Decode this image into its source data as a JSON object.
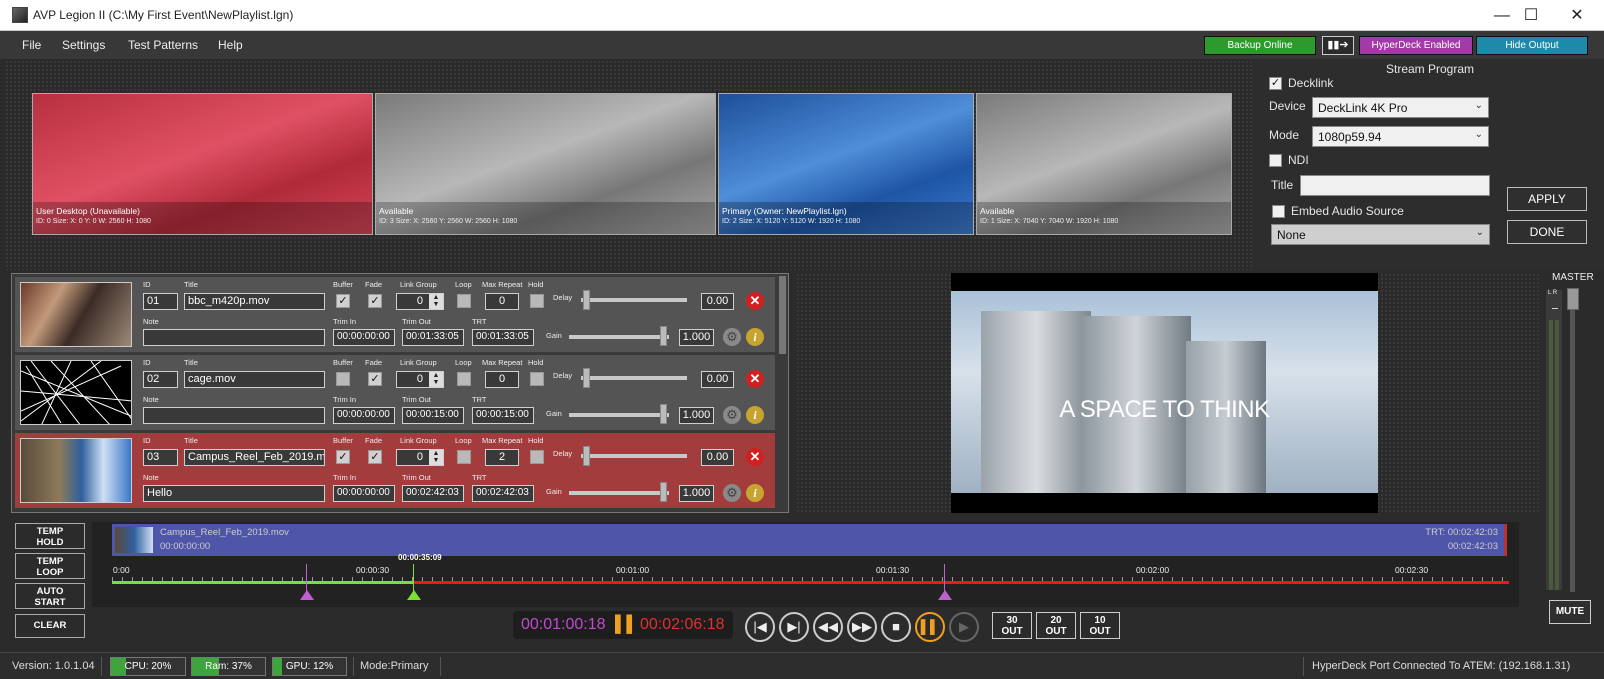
{
  "window": {
    "title": "AVP Legion II (C:\\My First Event\\NewPlaylist.lgn)",
    "minimize": "—",
    "maximize": "☐",
    "close": "✕"
  },
  "menu": [
    "File",
    "Settings",
    "Test Patterns",
    "Help"
  ],
  "topbar": {
    "backup": "Backup Online",
    "hyperdeck": "HyperDeck Enabled",
    "hide_output": "Hide Output"
  },
  "displays": [
    {
      "title": "User Desktop (Unavailable)",
      "info": "ID: 0 Size: X: 0 Y: 0 W: 2560 H: 1080",
      "color": "#c8394a"
    },
    {
      "title": "Available",
      "info": "ID: 3 Size: X: 2560 Y: 2560 W: 2560 H: 1080",
      "color": "#8a8a8a"
    },
    {
      "title": "Primary (Owner: NewPlaylist.lgn)",
      "info": "ID: 2 Size: X: 5120 Y: 5120 W: 1920 H: 1080",
      "color": "#2e68b8"
    },
    {
      "title": "Available",
      "info": "ID: 1 Size: X: 7040 Y: 7040 W: 1920 H: 1080",
      "color": "#8a8a8a"
    }
  ],
  "stream": {
    "heading": "Stream Program",
    "decklink_label": "Decklink",
    "decklink_checked": true,
    "device_label": "Device",
    "device_value": "DeckLink 4K Pro",
    "mode_label": "Mode",
    "mode_value": "1080p59.94",
    "ndi_label": "NDI",
    "title_label": "Title",
    "title_value": "",
    "embed_label": "Embed Audio Source",
    "embed_value": "None",
    "apply": "APPLY",
    "done": "DONE"
  },
  "field_labels": {
    "id": "ID",
    "title": "Title",
    "buffer": "Buffer",
    "fade": "Fade",
    "link_group": "Link Group",
    "loop": "Loop",
    "max_repeat": "Max Repeat",
    "hold": "Hold",
    "delay": "Delay",
    "note": "Note",
    "trim_in": "Trim In",
    "trim_out": "Trim Out",
    "trt": "TRT",
    "gain": "Gain"
  },
  "playlist": [
    {
      "id": "01",
      "title": "bbc_m420p.mov",
      "buffer": true,
      "fade": true,
      "link_group": "0",
      "loop": false,
      "max_repeat": "0",
      "hold": false,
      "delay": "0.00",
      "note": "",
      "trim_in": "00:00:00:00",
      "trim_out": "00:01:33:05",
      "trt": "00:01:33:05",
      "gain": "1.000"
    },
    {
      "id": "02",
      "title": "cage.mov",
      "buffer": false,
      "fade": true,
      "link_group": "0",
      "loop": false,
      "max_repeat": "0",
      "hold": false,
      "delay": "0.00",
      "note": "",
      "trim_in": "00:00:00:00",
      "trim_out": "00:00:15:00",
      "trt": "00:00:15:00",
      "gain": "1.000"
    },
    {
      "id": "03",
      "title": "Campus_Reel_Feb_2019.mov",
      "buffer": true,
      "fade": true,
      "link_group": "0",
      "loop": false,
      "max_repeat": "2",
      "hold": false,
      "delay": "0.00",
      "note": "Hello",
      "trim_in": "00:00:00:00",
      "trim_out": "00:02:42:03",
      "trt": "00:02:42:03",
      "gain": "1.000"
    }
  ],
  "preview": {
    "overlay_text": "A SPACE TO THINK"
  },
  "master": {
    "label": "MASTER",
    "lr": "L R",
    "mute": "MUTE"
  },
  "side_buttons": {
    "temp_hold": "TEMP\nHOLD",
    "temp_loop": "TEMP\nLOOP",
    "auto_start": "AUTO\nSTART",
    "clear": "CLEAR"
  },
  "timeline": {
    "clip_name": "Campus_Reel_Feb_2019.mov",
    "clip_start": "00:00:00:00",
    "trt": "TRT: 00:02:42:03",
    "trt_end": "00:02:42:03",
    "playhead": "00:00:35:09",
    "ticks": [
      "0:00",
      "00:00:30",
      "00:01:00",
      "00:01:30",
      "00:02:00",
      "00:02:30"
    ]
  },
  "transport": {
    "elapsed": "00:01:00:18",
    "remaining": "00:02:06:18",
    "out30": "30\nOUT",
    "out20": "20\nOUT",
    "out10": "10\nOUT"
  },
  "status": {
    "version": "Version: 1.0.1.04",
    "cpu": "CPU: 20%",
    "cpu_pct": 20,
    "ram": "Ram: 37%",
    "ram_pct": 37,
    "gpu": "GPU: 12%",
    "gpu_pct": 12,
    "mode": "Mode:Primary",
    "hyperdeck": "HyperDeck Port Connected To ATEM: (192.168.1.31)"
  },
  "colors": {
    "accent_green": "#2e9a2e",
    "accent_purple": "#a23aa8",
    "accent_teal": "#1c8aa8",
    "timeline_green": "#7be033",
    "timeline_red": "#e02020"
  }
}
